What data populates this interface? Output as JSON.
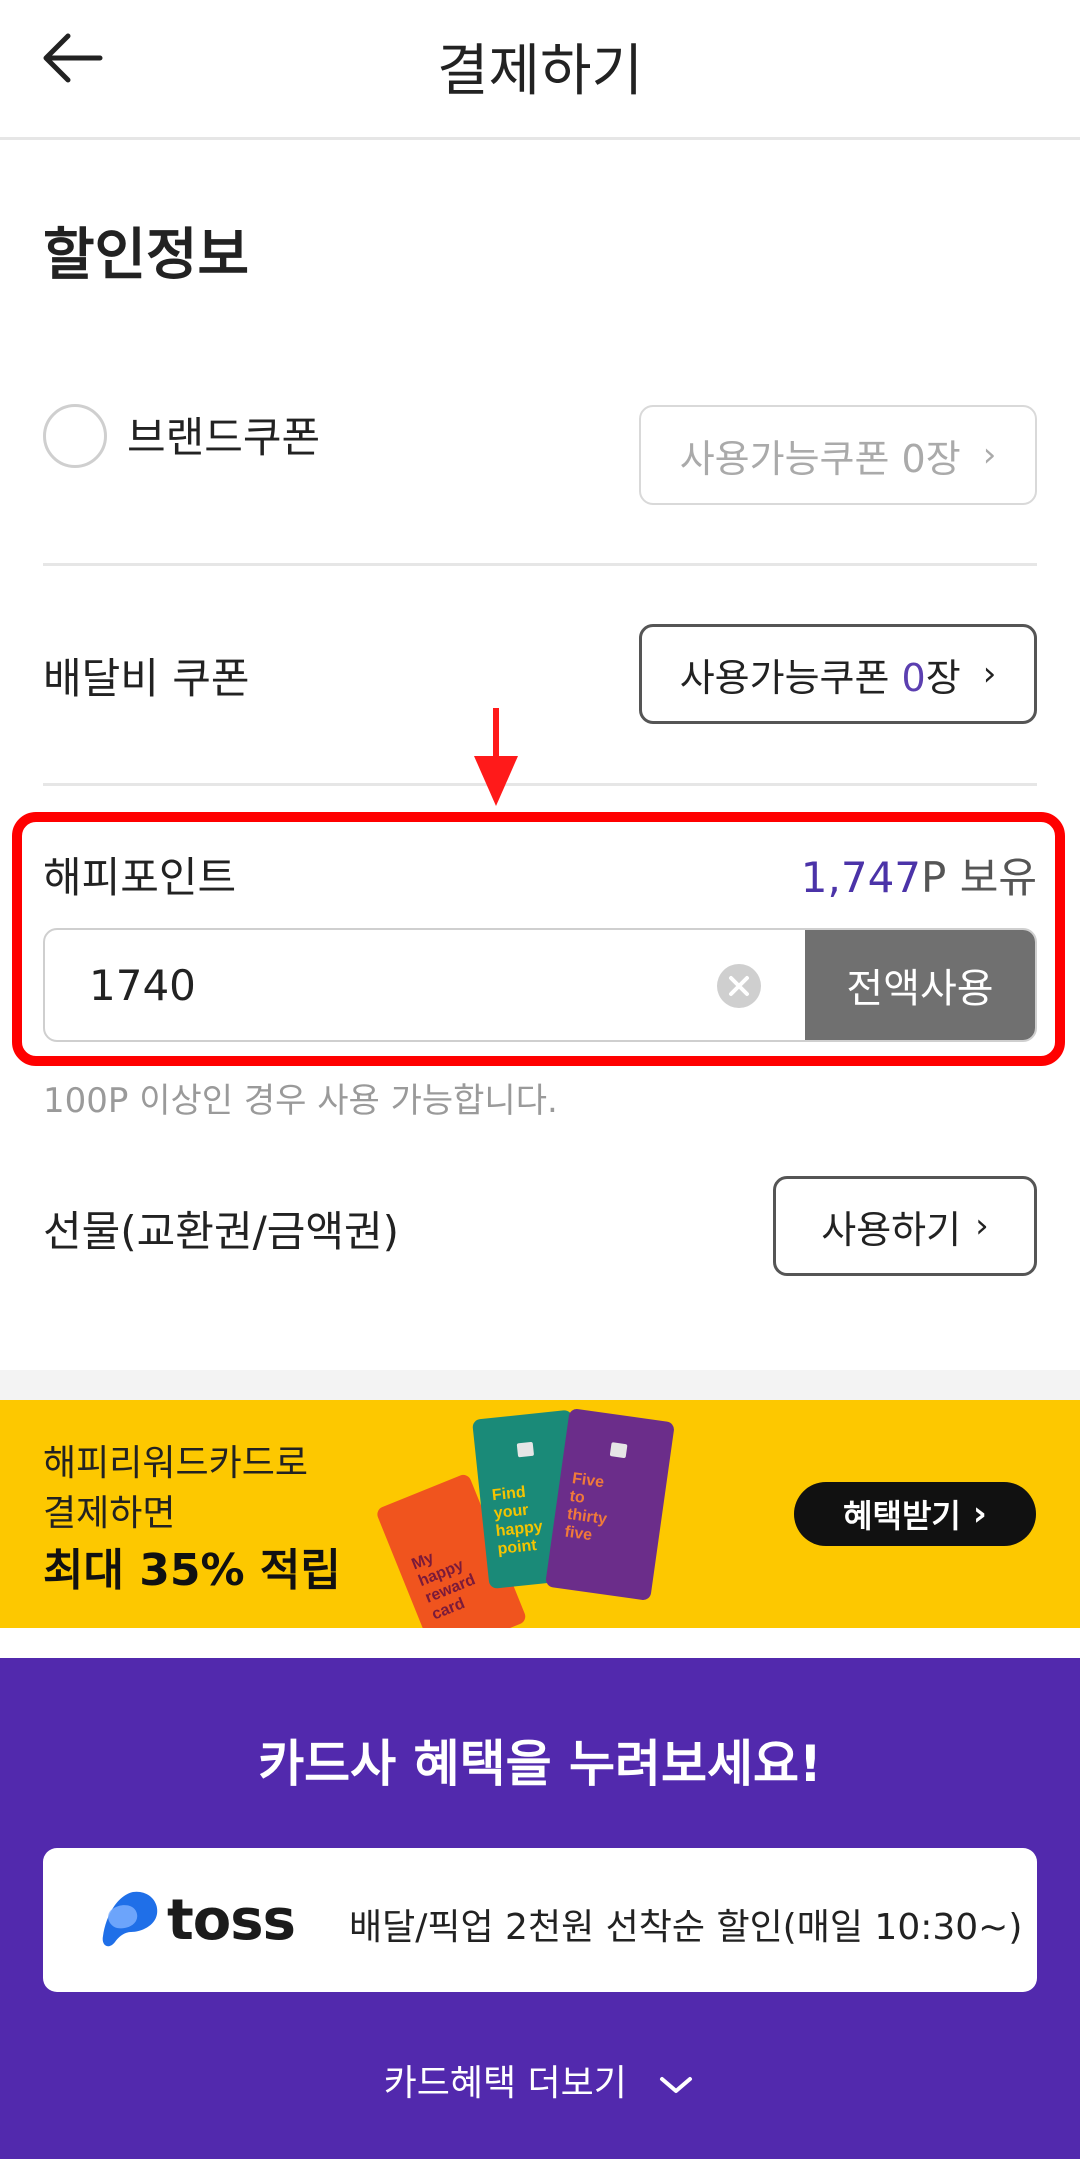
{
  "header": {
    "title": "결제하기",
    "back_icon": "arrow-left-icon"
  },
  "discount": {
    "section_title": "할인정보",
    "brand_coupon": {
      "label": "브랜드쿠폰",
      "button_prefix": "사용가능쿠폰 ",
      "count": "0",
      "button_suffix": "장"
    },
    "delivery_coupon": {
      "label": "배달비 쿠폰",
      "button_prefix": "사용가능쿠폰 ",
      "count": "0",
      "button_suffix": "장"
    },
    "happy_point": {
      "label": "해피포인트",
      "owned_value": "1,747",
      "owned_suffix": "P 보유",
      "input_value": "1740",
      "use_all_label": "전액사용",
      "hint": "100P 이상인 경우 사용 가능합니다."
    },
    "gift": {
      "label": "선물(교환권/금액권)",
      "button_label": "사용하기"
    }
  },
  "banner": {
    "line1": "해피리워드카드로",
    "line2": "결제하면",
    "line3": "최대 35% 적립",
    "button_label": "혜택받기",
    "cards": [
      {
        "text": "My happy reward card",
        "color": "#f0541e"
      },
      {
        "text": "Find your happy point",
        "color": "#1a8a78"
      },
      {
        "text": "Five to thirty five",
        "color": "#6b2d8a"
      }
    ]
  },
  "card_benefits": {
    "title": "카드사 혜택을 누려보세요!",
    "toss": {
      "brand": "toss",
      "description": "배달/픽업 2천원 선착순 할인(매일 10:30~)"
    },
    "more_label": "카드혜택 더보기"
  },
  "colors": {
    "accent_purple": "#5229ad",
    "highlight_red": "#ff0000",
    "banner_yellow": "#fdc800"
  }
}
